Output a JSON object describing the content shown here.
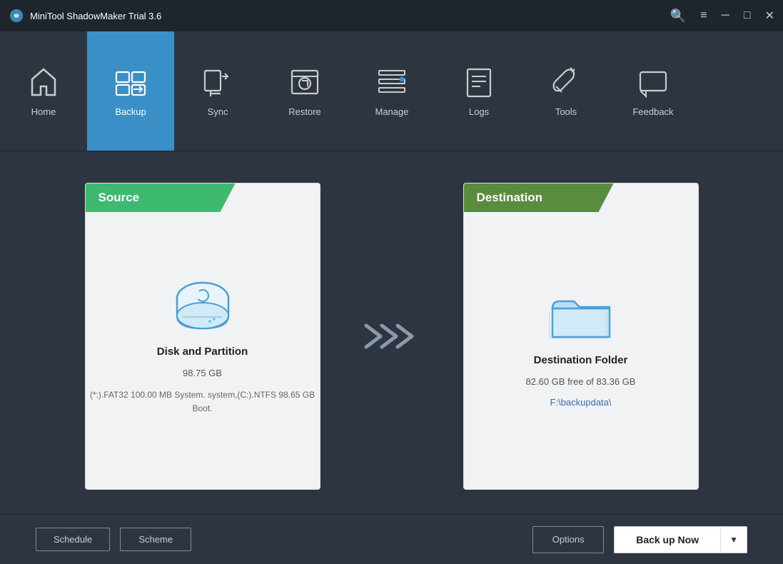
{
  "titleBar": {
    "title": "MiniTool ShadowMaker Trial 3.6",
    "controls": {
      "search": "⚲",
      "menu": "☰",
      "minimize": "─",
      "maximize": "□",
      "close": "✕"
    }
  },
  "nav": {
    "items": [
      {
        "id": "home",
        "label": "Home",
        "active": false
      },
      {
        "id": "backup",
        "label": "Backup",
        "active": true
      },
      {
        "id": "sync",
        "label": "Sync",
        "active": false
      },
      {
        "id": "restore",
        "label": "Restore",
        "active": false
      },
      {
        "id": "manage",
        "label": "Manage",
        "active": false
      },
      {
        "id": "logs",
        "label": "Logs",
        "active": false
      },
      {
        "id": "tools",
        "label": "Tools",
        "active": false
      },
      {
        "id": "feedback",
        "label": "Feedback",
        "active": false
      }
    ]
  },
  "source": {
    "header": "Source",
    "title": "Disk and Partition",
    "size": "98.75 GB",
    "detail": "(*:).FAT32 100.00 MB System. system,(C:).NTFS 98.65 GB Boot."
  },
  "destination": {
    "header": "Destination",
    "title": "Destination Folder",
    "freeSpace": "82.60 GB free of 83.36 GB",
    "path": "F:\\backupdata\\"
  },
  "bottomBar": {
    "schedule": "Schedule",
    "scheme": "Scheme",
    "options": "Options",
    "backupNow": "Back up Now",
    "dropdownArrow": "▼"
  }
}
